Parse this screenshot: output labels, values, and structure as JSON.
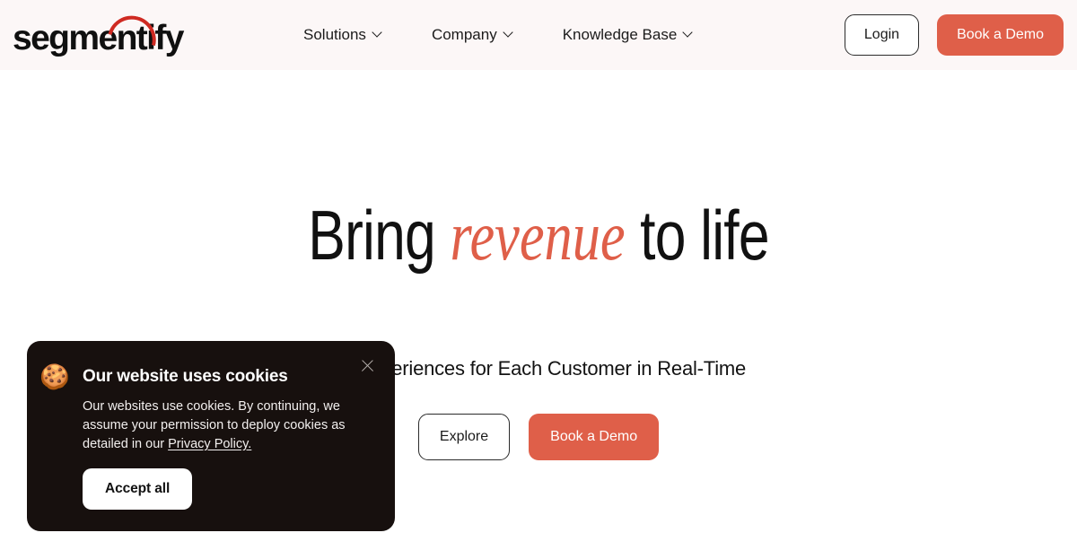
{
  "brand": {
    "logo_text": "segmentify",
    "accent_color": "#df5f49",
    "logo_arc_color": "#cf2a22",
    "header_bg": "#fcf7f7"
  },
  "header": {
    "nav": [
      {
        "label": "Solutions",
        "icon": "chevron-down-icon"
      },
      {
        "label": "Company",
        "icon": "chevron-down-icon"
      },
      {
        "label": "Knowledge Base",
        "icon": "chevron-down-icon"
      }
    ],
    "login_label": "Login",
    "demo_label": "Book a Demo"
  },
  "hero": {
    "title_part1": "Bring ",
    "title_accent": "revenue",
    "title_part2": " to life",
    "subtitle": "ue Experiences for Each Customer in Real-Time",
    "explore_label": "Explore",
    "demo_label": "Book a Demo"
  },
  "cookie_banner": {
    "icon": "cookie-emoji",
    "emoji": "🍪",
    "title": "Our website uses cookies",
    "body_text": "Our websites use cookies. By continuing, we assume your permission to deploy cookies as detailed in our ",
    "link_text": "Privacy Policy.",
    "accept_label": "Accept all",
    "close_icon": "close-icon",
    "bg_color": "#17100e"
  }
}
